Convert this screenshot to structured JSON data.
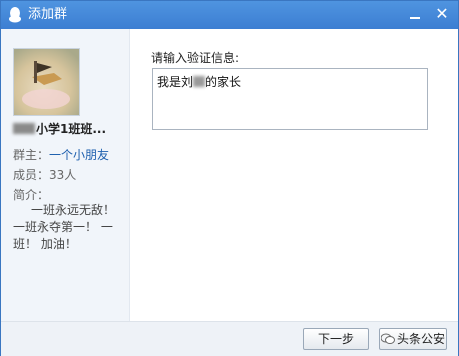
{
  "window": {
    "title": "添加群"
  },
  "group": {
    "name_suffix": "小学1班班...",
    "owner_label": "群主：",
    "owner_name": "一个小朋友",
    "members_label": "成员：",
    "members_value": "33人",
    "intro_label": "简介：",
    "intro_text": "一班永远无敌！一班永夺第一！ 一班！ 加油！"
  },
  "verify": {
    "label": "请输入验证信息:",
    "text_prefix": "我是刘",
    "text_suffix": "的家长"
  },
  "footer": {
    "next_button": "下一步",
    "cancel_button": "头条公安"
  },
  "colors": {
    "titlebar": "#4a8ee0",
    "link": "#1d5fae",
    "panel": "#f1f5fa"
  }
}
